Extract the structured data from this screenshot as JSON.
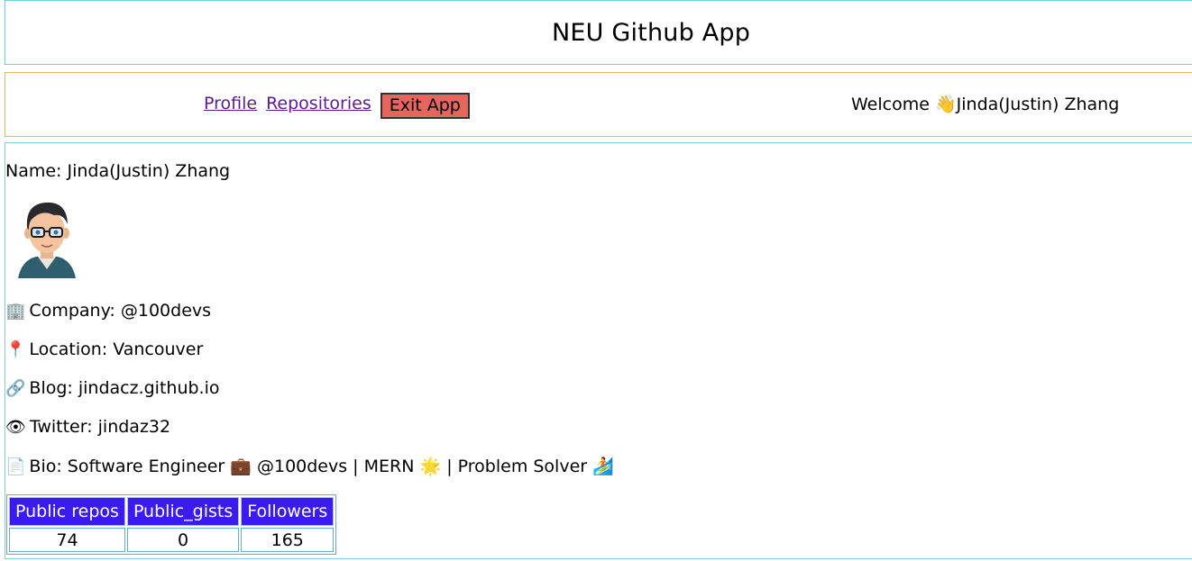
{
  "header": {
    "title": "NEU Github App"
  },
  "nav": {
    "profile_link": "Profile",
    "repositories_link": "Repositories",
    "exit_button": "Exit App",
    "welcome_prefix": "Welcome",
    "welcome_emoji": "👋",
    "welcome_name": "Jinda(Justin) Zhang"
  },
  "profile": {
    "name_label": "Name: Jinda(Justin) Zhang",
    "company": {
      "icon": "🏢",
      "text": "Company: @100devs"
    },
    "location": {
      "icon": "📍",
      "text": "Location: Vancouver"
    },
    "blog": {
      "icon": "🔗",
      "text": "Blog: jindacz.github.io"
    },
    "twitter": {
      "icon": "👁",
      "text": "Twitter: jindaz32"
    },
    "bio": {
      "icon": "📄",
      "text_a": "Bio: Software Engineer",
      "emoji_a": "💼",
      "text_b": "@100devs | MERN",
      "emoji_b": "🌟",
      "text_c": "| Problem Solver",
      "emoji_c": "🏄"
    }
  },
  "stats": {
    "headers": [
      "Public repos",
      "Public_gists",
      "Followers"
    ],
    "values": [
      "74",
      "0",
      "165"
    ]
  },
  "colors": {
    "table_header_bg": "#3a1cf0",
    "exit_button_bg": "#e6655f",
    "link_color": "#5a1a9c"
  }
}
